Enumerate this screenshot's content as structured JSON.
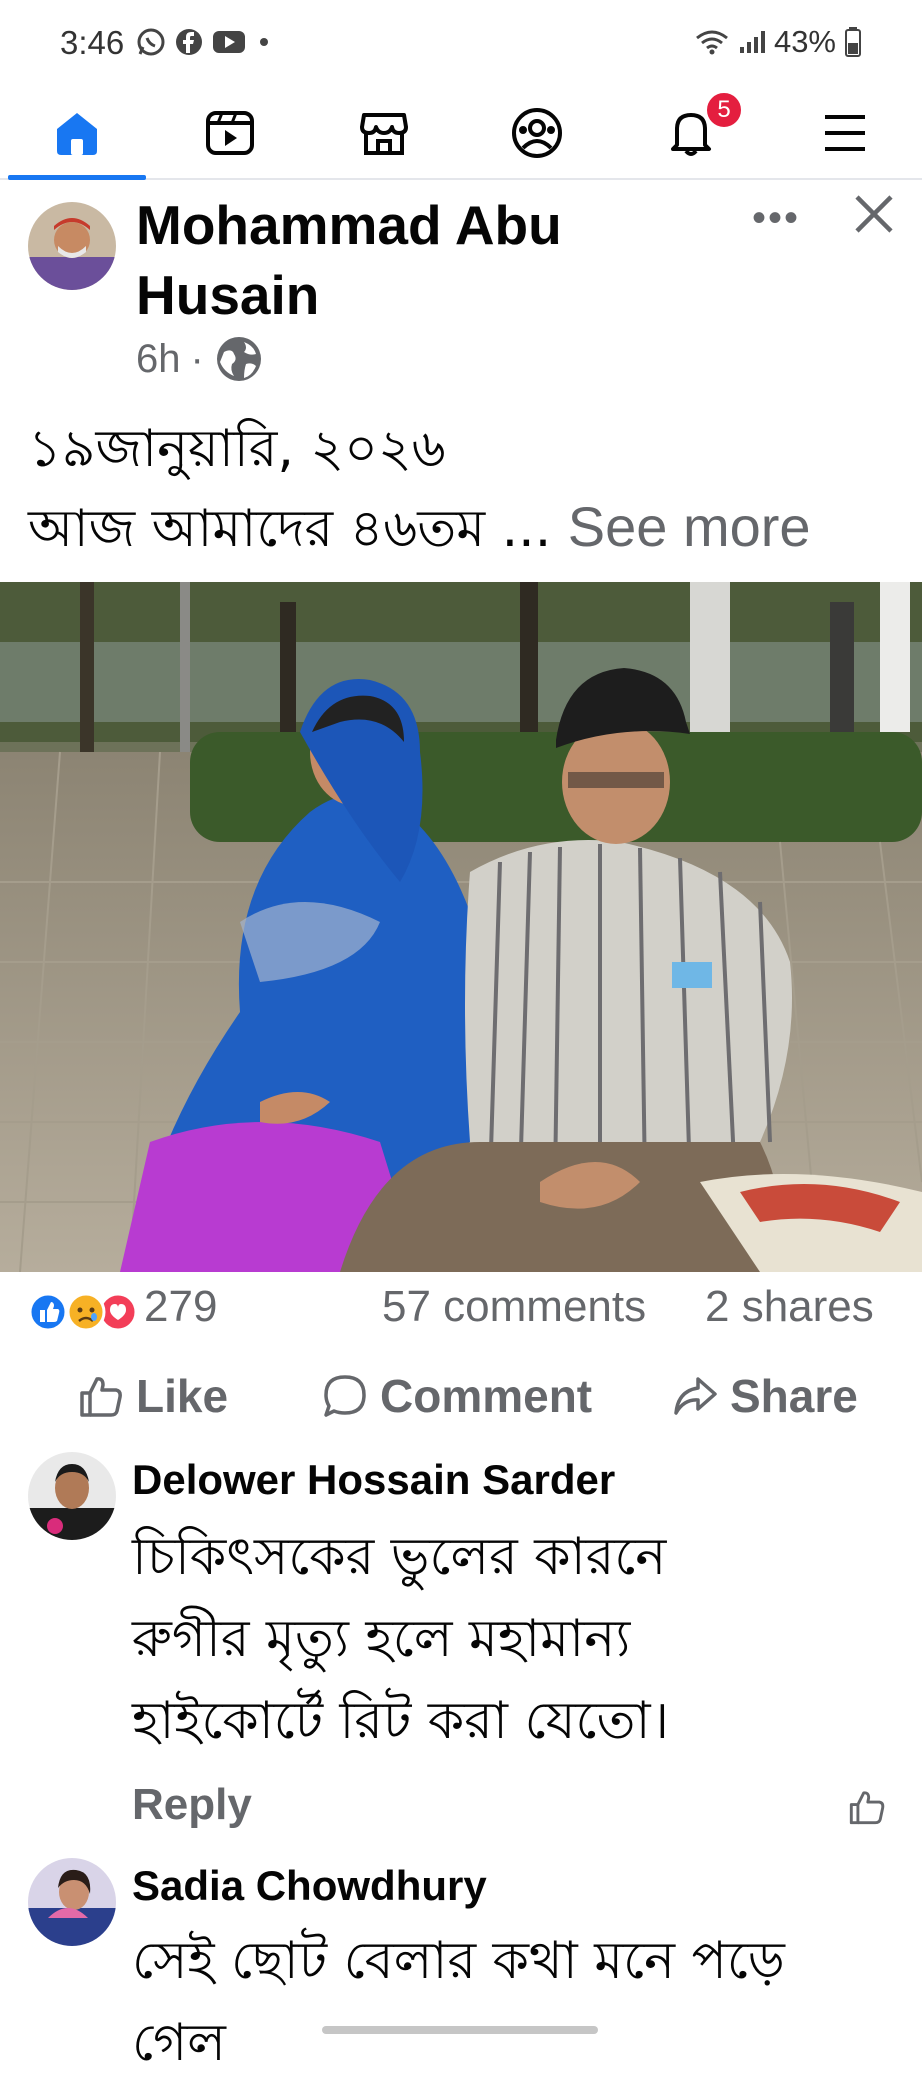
{
  "status_bar": {
    "time": "3:46",
    "battery": "43%",
    "icons": [
      "whatsapp-icon",
      "facebook-icon",
      "youtube-icon",
      "dot-icon",
      "wifi-icon",
      "signal-icon",
      "battery-icon"
    ]
  },
  "nav": {
    "items": [
      "home-icon",
      "video-icon",
      "marketplace-icon",
      "profile-icon",
      "notifications-icon",
      "menu-icon"
    ],
    "notification_badge": "5",
    "active": "home"
  },
  "post": {
    "author": "Mohammad Abu Husain",
    "time": "6h",
    "separator": "·",
    "text_line1": "১৯জানুয়ারি, ২০২৬",
    "text_line2": "আজ আমাদের ৪৬তম ...",
    "see_more": "See more",
    "reaction_count": "279",
    "comments": "57 comments",
    "shares": "2 shares"
  },
  "actions": {
    "like": "Like",
    "comment": "Comment",
    "share": "Share"
  },
  "comments": [
    {
      "name": "Delower Hossain Sarder",
      "line1": "চিকিৎসকের ভুলের কারনে",
      "line2": "রুগীর মৃত্যু হলে মহামান্য",
      "line3": "হাইকোর্টে রিট করা যেতো।",
      "reply": "Reply"
    },
    {
      "name": "Sadia Chowdhury",
      "line1": "সেই ছোট বেলার কথা মনে পড়ে",
      "line2": "গেল"
    }
  ],
  "colors": {
    "accent": "#1877f2",
    "badge": "#e41e3f",
    "secondary_text": "#65676b"
  }
}
